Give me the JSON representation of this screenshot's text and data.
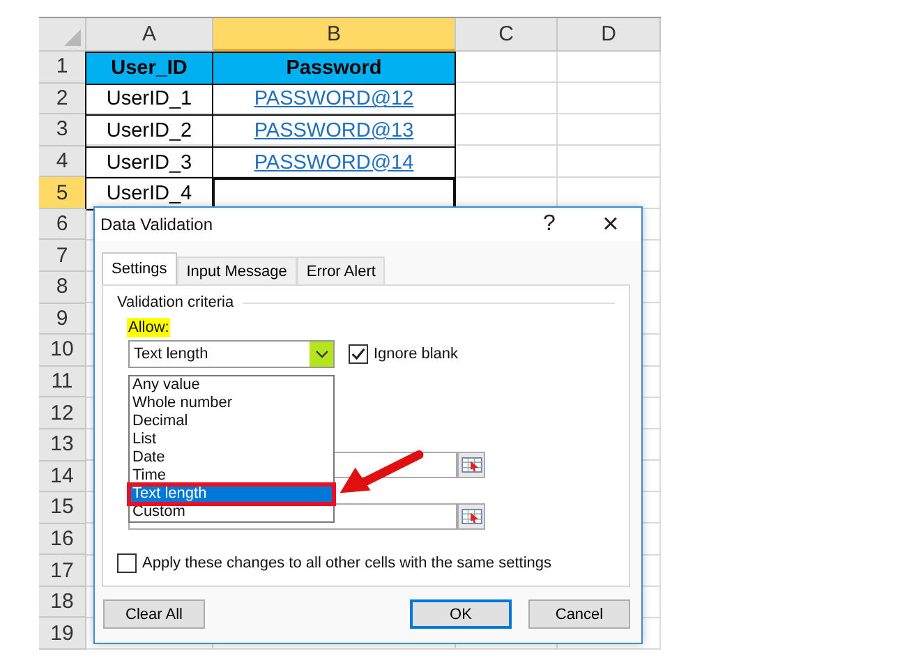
{
  "sheet": {
    "columns": [
      {
        "label": "A",
        "selected": false
      },
      {
        "label": "B",
        "selected": true
      },
      {
        "label": "C",
        "selected": false
      },
      {
        "label": "D",
        "selected": false
      }
    ],
    "rows": [
      {
        "number": "1",
        "selected": false,
        "cells": [
          {
            "text": "User_ID",
            "kind": "header",
            "selected": false
          },
          {
            "text": "Password",
            "kind": "header",
            "selected": false
          }
        ]
      },
      {
        "number": "2",
        "selected": false,
        "cells": [
          {
            "text": "UserID_1",
            "kind": "text",
            "selected": false
          },
          {
            "text": "PASSWORD@12",
            "kind": "link",
            "selected": false
          }
        ]
      },
      {
        "number": "3",
        "selected": false,
        "cells": [
          {
            "text": "UserID_2",
            "kind": "text",
            "selected": false
          },
          {
            "text": "PASSWORD@13",
            "kind": "link",
            "selected": false
          }
        ]
      },
      {
        "number": "4",
        "selected": false,
        "cells": [
          {
            "text": "UserID_3",
            "kind": "text",
            "selected": false
          },
          {
            "text": "PASSWORD@14",
            "kind": "link",
            "selected": false
          }
        ]
      },
      {
        "number": "5",
        "selected": true,
        "cells": [
          {
            "text": "UserID_4",
            "kind": "text",
            "selected": false
          },
          {
            "text": "",
            "kind": "text",
            "selected": true
          }
        ]
      },
      {
        "number": "6",
        "selected": false
      },
      {
        "number": "7",
        "selected": false
      },
      {
        "number": "8",
        "selected": false
      },
      {
        "number": "9",
        "selected": false
      },
      {
        "number": "10",
        "selected": false
      },
      {
        "number": "11",
        "selected": false
      },
      {
        "number": "12",
        "selected": false
      },
      {
        "number": "13",
        "selected": false
      },
      {
        "number": "14",
        "selected": false
      },
      {
        "number": "15",
        "selected": false
      },
      {
        "number": "16",
        "selected": false
      },
      {
        "number": "17",
        "selected": false
      },
      {
        "number": "18",
        "selected": false
      },
      {
        "number": "19",
        "selected": false
      }
    ]
  },
  "dialog": {
    "title": "Data Validation",
    "help": "?",
    "close": "×",
    "tabs": [
      {
        "label": "Settings",
        "selected": true
      },
      {
        "label": "Input Message",
        "selected": false
      },
      {
        "label": "Error Alert",
        "selected": false
      }
    ],
    "group_title": "Validation criteria",
    "allow_label": "Allow:",
    "allow_value": "Text length",
    "ignore_blank": {
      "label": "Ignore blank",
      "checked": true
    },
    "options": [
      {
        "label": "Any value",
        "selected": false
      },
      {
        "label": "Whole number",
        "selected": false
      },
      {
        "label": "Decimal",
        "selected": false
      },
      {
        "label": "List",
        "selected": false
      },
      {
        "label": "Date",
        "selected": false
      },
      {
        "label": "Time",
        "selected": false
      },
      {
        "label": "Text length",
        "selected": true
      },
      {
        "label": "Custom",
        "selected": false
      }
    ],
    "apply_all": {
      "label": "Apply these changes to all other cells with the same settings",
      "checked": false
    },
    "buttons": [
      {
        "label": "Clear All",
        "kind": "normal"
      },
      {
        "label": "OK",
        "kind": "default"
      },
      {
        "label": "Cancel",
        "kind": "normal"
      }
    ]
  }
}
